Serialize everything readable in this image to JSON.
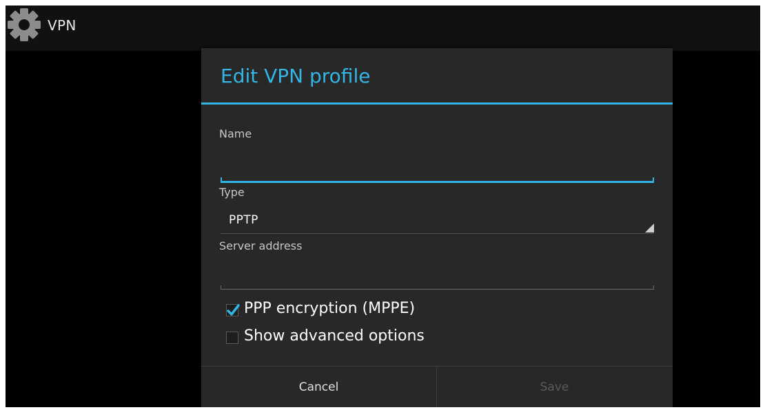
{
  "app_bar": {
    "icon": "gear-icon",
    "title": "VPN"
  },
  "dialog": {
    "title": "Edit VPN profile",
    "fields": {
      "name": {
        "label": "Name",
        "value": ""
      },
      "type": {
        "label": "Type",
        "value": "PPTP"
      },
      "server": {
        "label": "Server address",
        "value": ""
      }
    },
    "checkboxes": {
      "ppp_encryption": {
        "label": "PPP encryption (MPPE)",
        "checked": true
      },
      "advanced": {
        "label": "Show advanced options",
        "checked": false
      }
    },
    "buttons": {
      "cancel": "Cancel",
      "save": "Save"
    }
  },
  "colors": {
    "accent": "#33b5e5",
    "dialog_bg": "#282828",
    "disabled_text": "#5a5a5a"
  }
}
